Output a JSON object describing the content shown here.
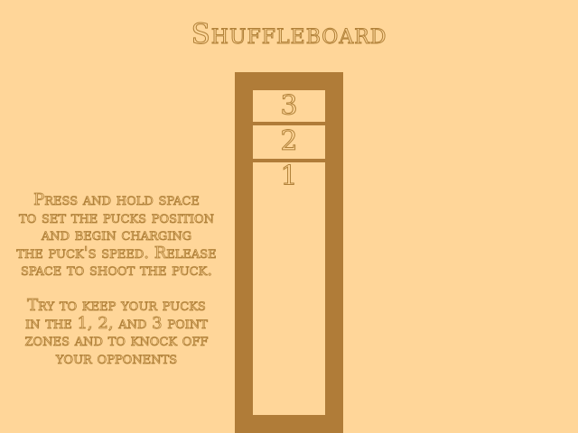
{
  "title": "Shuffleboard",
  "instructions": {
    "lines": [
      "Press and hold space",
      "to set the pucks position",
      "and begin charging",
      "the puck's speed. Release",
      "space to shoot the puck.",
      "",
      "Try to keep your pucks",
      "in the 1, 2, and 3 point",
      "zones and to knock off",
      "your opponents"
    ]
  },
  "board": {
    "zones": [
      {
        "label": "3"
      },
      {
        "label": "2"
      },
      {
        "label": "1"
      }
    ]
  },
  "colors": {
    "background": "#ffd699",
    "board": "#b07c38",
    "text_outline": "#b08038"
  }
}
